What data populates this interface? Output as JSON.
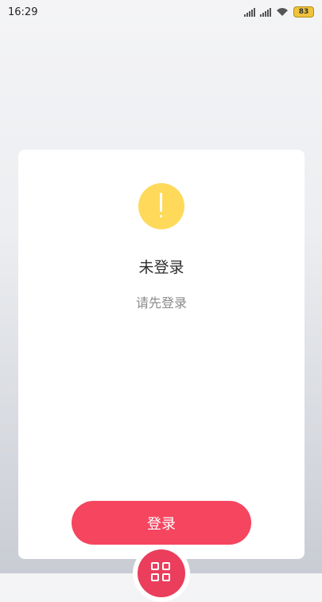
{
  "status_bar": {
    "time": "16:29",
    "battery": "83",
    "icons": [
      "signal-icon",
      "signal-icon",
      "wifi-icon",
      "battery-icon"
    ]
  },
  "card": {
    "icon": "warning-icon",
    "icon_color": "#ffd95a",
    "title": "未登录",
    "subtitle": "请先登录",
    "button_label": "登录",
    "button_color": "#f5455f"
  },
  "bottom": {
    "icon": "qr-code-icon",
    "accent": "#ea3e5c"
  }
}
